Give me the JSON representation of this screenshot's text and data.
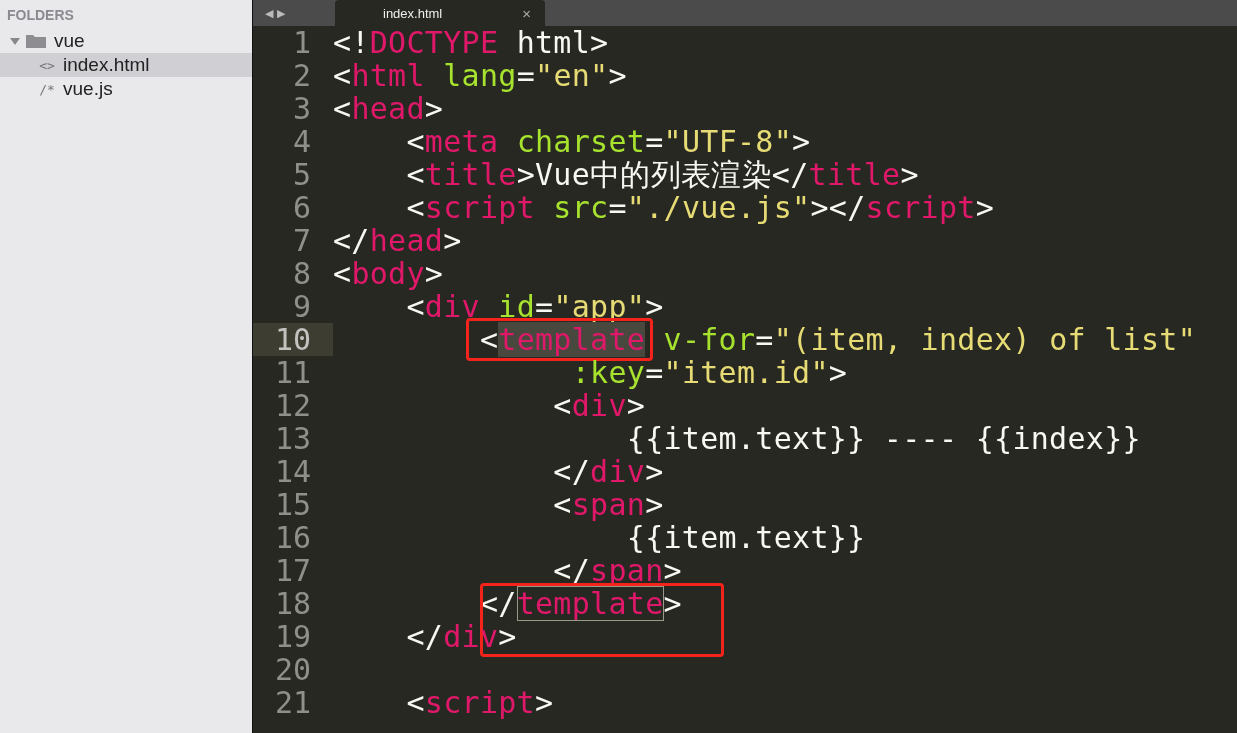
{
  "sidebar": {
    "title": "FOLDERS",
    "tree": [
      {
        "name": "vue",
        "kind": "folder",
        "expanded": true,
        "selected": false,
        "children": [
          {
            "name": "index.html",
            "kind": "file",
            "icon": "<>",
            "selected": true
          },
          {
            "name": "vue.js",
            "kind": "file",
            "icon": "/*",
            "selected": false
          }
        ]
      }
    ]
  },
  "tab_bar": {
    "nav": [
      "◀",
      "▶"
    ],
    "tabs": [
      {
        "label": "index.html",
        "close": "×",
        "selected": true
      }
    ]
  },
  "editor": {
    "lines": [
      {
        "number": "1",
        "current": false,
        "tokens": [
          {
            "kind": "plain",
            "text": "<!"
          },
          {
            "kind": "tag",
            "text": "DOCTYPE"
          },
          {
            "kind": "plain",
            "text": " html>"
          }
        ]
      },
      {
        "number": "2",
        "current": false,
        "tokens": [
          {
            "kind": "plain",
            "text": "<"
          },
          {
            "kind": "tag",
            "text": "html"
          },
          {
            "kind": "attr",
            "text": " lang"
          },
          {
            "kind": "plain",
            "text": "="
          },
          {
            "kind": "string",
            "text": "\"en\""
          },
          {
            "kind": "plain",
            "text": ">"
          }
        ]
      },
      {
        "number": "3",
        "current": false,
        "tokens": [
          {
            "kind": "plain",
            "text": "<"
          },
          {
            "kind": "tag",
            "text": "head"
          },
          {
            "kind": "plain",
            "text": ">"
          }
        ]
      },
      {
        "number": "4",
        "current": false,
        "tokens": [
          {
            "kind": "plain",
            "text": "    <"
          },
          {
            "kind": "tag",
            "text": "meta"
          },
          {
            "kind": "attr",
            "text": " charset"
          },
          {
            "kind": "plain",
            "text": "="
          },
          {
            "kind": "string",
            "text": "\"UTF-8\""
          },
          {
            "kind": "plain",
            "text": ">"
          }
        ]
      },
      {
        "number": "5",
        "current": false,
        "tokens": [
          {
            "kind": "plain",
            "text": "    <"
          },
          {
            "kind": "tag",
            "text": "title"
          },
          {
            "kind": "plain",
            "text": ">Vue中的列表渲染</"
          },
          {
            "kind": "tag",
            "text": "title"
          },
          {
            "kind": "plain",
            "text": ">"
          }
        ]
      },
      {
        "number": "6",
        "current": false,
        "tokens": [
          {
            "kind": "plain",
            "text": "    <"
          },
          {
            "kind": "tag",
            "text": "script"
          },
          {
            "kind": "attr",
            "text": " src"
          },
          {
            "kind": "plain",
            "text": "="
          },
          {
            "kind": "string",
            "text": "\"./vue.js\""
          },
          {
            "kind": "plain",
            "text": "></"
          },
          {
            "kind": "tag",
            "text": "script"
          },
          {
            "kind": "plain",
            "text": ">"
          }
        ]
      },
      {
        "number": "7",
        "current": false,
        "tokens": [
          {
            "kind": "plain",
            "text": "</"
          },
          {
            "kind": "tag",
            "text": "head"
          },
          {
            "kind": "plain",
            "text": ">"
          }
        ]
      },
      {
        "number": "8",
        "current": false,
        "tokens": [
          {
            "kind": "plain",
            "text": "<"
          },
          {
            "kind": "tag",
            "text": "body"
          },
          {
            "kind": "plain",
            "text": ">"
          }
        ]
      },
      {
        "number": "9",
        "current": false,
        "tokens": [
          {
            "kind": "plain",
            "text": "    <"
          },
          {
            "kind": "tag",
            "text": "div"
          },
          {
            "kind": "attr",
            "text": " id"
          },
          {
            "kind": "plain",
            "text": "="
          },
          {
            "kind": "string",
            "text": "\"app\""
          },
          {
            "kind": "plain",
            "text": ">"
          }
        ]
      },
      {
        "number": "10",
        "current": true,
        "tokens": [
          {
            "kind": "plain",
            "text": "        <"
          },
          {
            "kind": "boxed-selected-tag",
            "text": "template"
          },
          {
            "kind": "attr",
            "text": " v-for"
          },
          {
            "kind": "plain",
            "text": "="
          },
          {
            "kind": "string",
            "text": "\"(item, index) of list\""
          }
        ]
      },
      {
        "number": "11",
        "current": false,
        "tokens": [
          {
            "kind": "attr",
            "text": "             :key"
          },
          {
            "kind": "plain",
            "text": "="
          },
          {
            "kind": "string",
            "text": "\"item.id\""
          },
          {
            "kind": "plain",
            "text": ">"
          }
        ]
      },
      {
        "number": "12",
        "current": false,
        "tokens": [
          {
            "kind": "plain",
            "text": "            <"
          },
          {
            "kind": "tag",
            "text": "div"
          },
          {
            "kind": "plain",
            "text": ">"
          }
        ]
      },
      {
        "number": "13",
        "current": false,
        "tokens": [
          {
            "kind": "plain",
            "text": "                {{item.text}} ---- {{index}}"
          }
        ]
      },
      {
        "number": "14",
        "current": false,
        "tokens": [
          {
            "kind": "plain",
            "text": "            </"
          },
          {
            "kind": "tag",
            "text": "div"
          },
          {
            "kind": "plain",
            "text": ">"
          }
        ]
      },
      {
        "number": "15",
        "current": false,
        "tokens": [
          {
            "kind": "plain",
            "text": "            <"
          },
          {
            "kind": "tag",
            "text": "span"
          },
          {
            "kind": "plain",
            "text": ">"
          }
        ]
      },
      {
        "number": "16",
        "current": false,
        "tokens": [
          {
            "kind": "plain",
            "text": "                {{item.text}}"
          }
        ]
      },
      {
        "number": "17",
        "current": false,
        "tokens": [
          {
            "kind": "plain",
            "text": "            </"
          },
          {
            "kind": "tag",
            "text": "span"
          },
          {
            "kind": "plain",
            "text": ">"
          }
        ]
      },
      {
        "number": "18",
        "current": false,
        "tokens": [
          {
            "kind": "plain",
            "text": "        <"
          },
          {
            "kind": "boxed-plain",
            "text": "/"
          },
          {
            "kind": "matched-tag",
            "text": "template"
          },
          {
            "kind": "plain",
            "text": ">"
          }
        ]
      },
      {
        "number": "19",
        "current": false,
        "tokens": [
          {
            "kind": "plain",
            "text": "    </"
          },
          {
            "kind": "tag",
            "text": "div"
          },
          {
            "kind": "plain",
            "text": ">"
          }
        ]
      },
      {
        "number": "20",
        "current": false
      },
      {
        "number": "21",
        "current": false,
        "tokens": [
          {
            "kind": "plain",
            "text": "    <"
          },
          {
            "kind": "tag",
            "text": "script"
          },
          {
            "kind": "plain",
            "text": ">"
          }
        ]
      }
    ]
  }
}
